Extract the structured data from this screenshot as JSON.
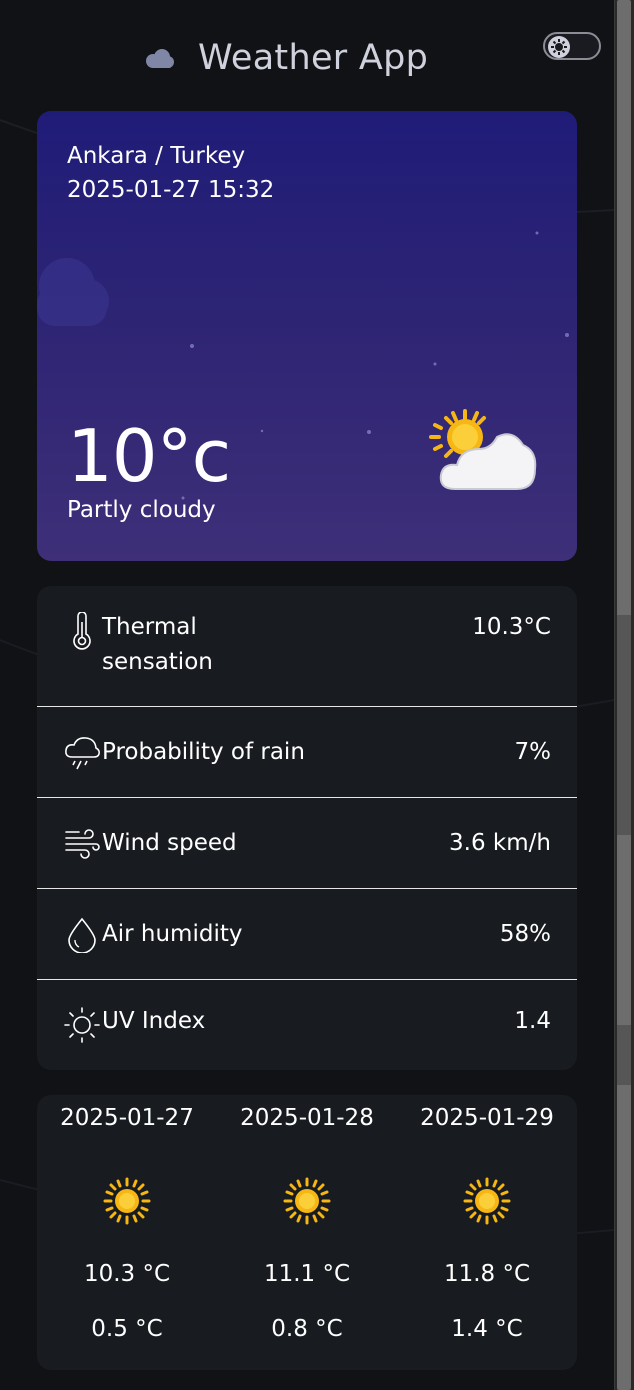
{
  "app": {
    "title": "Weather App"
  },
  "current": {
    "location": "Ankara / Turkey",
    "datetime": "2025-01-27 15:32",
    "temperature": "10°c",
    "description": "Partly cloudy",
    "icon": "partly-cloudy-icon"
  },
  "details": [
    {
      "icon": "thermometer-icon",
      "label": "Thermal sensation",
      "value": "10.3°C"
    },
    {
      "icon": "rain-cloud-icon",
      "label": "Probability of rain",
      "value": "7%"
    },
    {
      "icon": "wind-icon",
      "label": "Wind speed",
      "value": "3.6 km/h"
    },
    {
      "icon": "droplet-icon",
      "label": "Air humidity",
      "value": "58%"
    },
    {
      "icon": "sun-outline-icon",
      "label": "UV Index",
      "value": "1.4"
    }
  ],
  "forecast": [
    {
      "date": "2025-01-27",
      "icon": "sun-icon",
      "max": "10.3 °C",
      "min": "0.5 °C"
    },
    {
      "date": "2025-01-28",
      "icon": "sun-icon",
      "max": "11.1 °C",
      "min": "0.8 °C"
    },
    {
      "date": "2025-01-29",
      "icon": "sun-icon",
      "max": "11.8 °C",
      "min": "1.4 °C"
    }
  ],
  "colors": {
    "background": "#111216",
    "card": "#181b20",
    "hero_top": "#1f1c78",
    "hero_bottom": "#3e2f78",
    "sun": "#f6b614"
  }
}
